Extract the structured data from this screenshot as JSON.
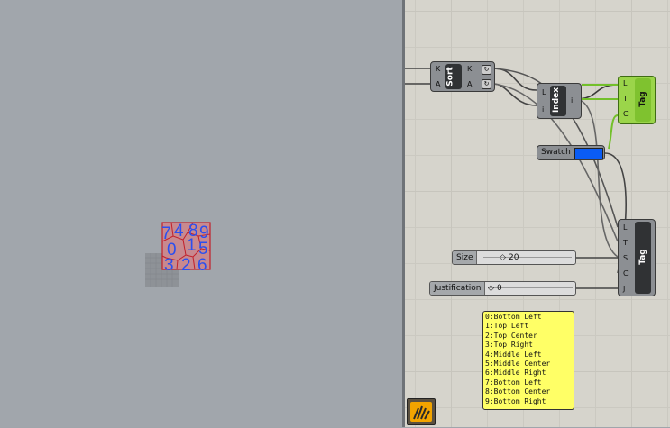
{
  "viewport": {
    "tags_row1": [
      "7",
      "4",
      "8",
      "9"
    ],
    "tags_row2": [
      "0",
      "1",
      "5"
    ],
    "tags_row3": [
      "3",
      "2",
      "6"
    ],
    "tag_color": "#2a4ff0",
    "cell_color": "#d24a6a"
  },
  "sort": {
    "title": "Sort",
    "in_k": "K",
    "in_a": "A",
    "out_k": "K",
    "out_a": "A"
  },
  "index": {
    "title": "Index",
    "in_l": "L",
    "in_i": "i",
    "out_i": "i"
  },
  "tag_top": {
    "title": "Tag",
    "pins": [
      "L",
      "T",
      "C"
    ]
  },
  "tag_bottom": {
    "title": "Tag",
    "pins": [
      "L",
      "T",
      "S",
      "C",
      "J"
    ]
  },
  "swatch": {
    "label": "Swatch",
    "color": "#0a5cf5"
  },
  "size_slider": {
    "label": "Size",
    "value": "20"
  },
  "justification_slider": {
    "label": "Justification",
    "value": "0"
  },
  "panel": {
    "lines": [
      "0:Bottom Left",
      "1:Top Left",
      "2:Top Center",
      "3:Top Right",
      "4:Middle Left",
      "5:Middle Center",
      "6:Middle Right",
      "7:Bottom Left",
      "8:Bottom Center",
      "9:Bottom Right"
    ]
  }
}
